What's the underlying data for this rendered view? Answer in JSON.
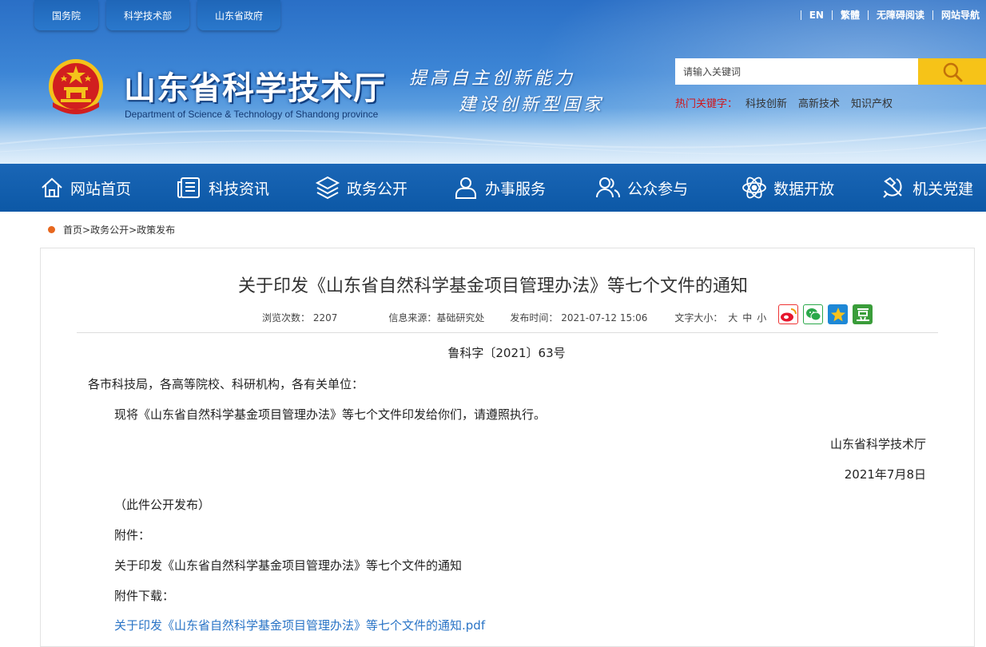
{
  "top_tabs": [
    "国务院",
    "科学技术部",
    "山东省政府"
  ],
  "top_links": [
    "EN",
    "繁體",
    "无障碍阅读",
    "网站导航"
  ],
  "header": {
    "title": "山东省科学技术厅",
    "subtitle": "Department of Science & Technology of Shandong province",
    "slogan_line1": "提高自主创新能力",
    "slogan_line2": "建设创新型国家"
  },
  "search": {
    "placeholder": "请输入关键词",
    "hot_label": "热门关键字：",
    "hot_words": [
      "科技创新",
      "高新技术",
      "知识产权"
    ]
  },
  "nav": [
    {
      "label": "网站首页",
      "icon": "home-icon"
    },
    {
      "label": "科技资讯",
      "icon": "news-icon"
    },
    {
      "label": "政务公开",
      "icon": "layers-icon"
    },
    {
      "label": "办事服务",
      "icon": "user-service-icon"
    },
    {
      "label": "公众参与",
      "icon": "users-icon"
    },
    {
      "label": "数据开放",
      "icon": "atom-icon"
    },
    {
      "label": "机关党建",
      "icon": "party-icon"
    }
  ],
  "breadcrumb": [
    "首页",
    "政务公开",
    "政策发布"
  ],
  "article": {
    "title": "关于印发《山东省自然科学基金项目管理办法》等七个文件的通知",
    "views_label": "浏览次数：",
    "views": "2207",
    "source_label": "信息来源：",
    "source": "基础研究处",
    "date_label": "发布时间：",
    "date": "2021-07-12 15:06",
    "fontsize_label": "文字大小：",
    "fontsizes": [
      "大",
      "中",
      "小"
    ],
    "doc_no": "鲁科字〔2021〕63号",
    "salutation": "各市科技局，各高等院校、科研机构，各有关单位：",
    "body": "现将《山东省自然科学基金项目管理办法》等七个文件印发给你们，请遵照执行。",
    "signer": "山东省科学技术厅",
    "sign_date": "2021年7月8日",
    "public_note": "（此件公开发布）",
    "attach_label": "附件：",
    "attach_item": "关于印发《山东省自然科学基金项目管理办法》等七个文件的通知",
    "download_label": "附件下载：",
    "download_link": "关于印发《山东省自然科学基金项目管理办法》等七个文件的通知.pdf"
  },
  "share_icons": [
    "weibo-icon",
    "wechat-icon",
    "qzone-icon",
    "douban-icon"
  ],
  "colors": {
    "nav": "#0c58a6",
    "search_button": "#f6c318",
    "hot_label": "#d0161b",
    "link": "#2a74c6"
  }
}
